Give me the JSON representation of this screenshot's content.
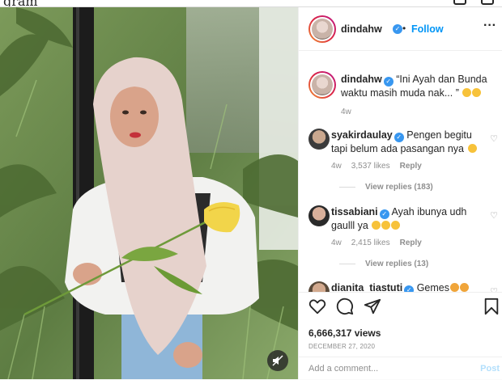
{
  "topbar": {
    "logo": "gram"
  },
  "post": {
    "author": {
      "username": "dindahw",
      "verified": true,
      "follow_label": "Follow",
      "separator": "•"
    },
    "caption": {
      "username": "dindahw",
      "text": "“Ini Ayah dan Bunda waktu masih muda nak... ”",
      "emojis": [
        "zany-face",
        "grinning-squinting-face"
      ],
      "age": "4w"
    },
    "comments": [
      {
        "username": "syakirdaulay",
        "text": "Pengen begitu tapi belum ada pasangan nya",
        "emojis": [
          "upside-down-face"
        ],
        "age": "4w",
        "likes": "3,537 likes",
        "reply_label": "Reply",
        "replies": "View replies (183)"
      },
      {
        "username": "tissabiani",
        "text": "Ayah ibunya udh gaulll ya",
        "emojis": [
          "winking-tongue-face",
          "winking-tongue-face",
          "winking-tongue-face"
        ],
        "age": "4w",
        "likes": "2,415 likes",
        "reply_label": "Reply",
        "replies": "View replies (13)"
      },
      {
        "username": "dianita_tiastuti",
        "text": "Gemes",
        "emojis": [
          "star-struck-face",
          "star-struck-face"
        ]
      }
    ],
    "views": "6,666,317 views",
    "date": "DECEMBER 27, 2020",
    "add_comment_placeholder": "Add a comment...",
    "post_button": "Post",
    "more_icon": "more-horizontal-icon",
    "like_icon": "heart-icon",
    "comment_icon": "comment-icon",
    "share_icon": "paper-plane-icon",
    "save_icon": "bookmark-icon",
    "mute_icon": "speaker-muted-icon"
  },
  "colors": {
    "accent": "#0095f6",
    "verified": "#3897f0",
    "muted_text": "#8e8e8e",
    "post_disabled": "#b2dffc"
  }
}
